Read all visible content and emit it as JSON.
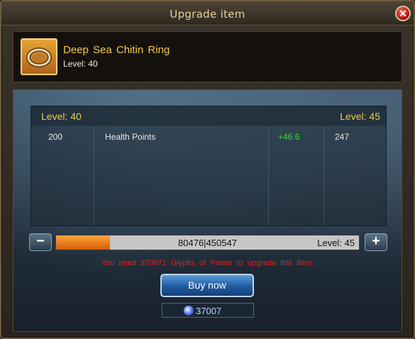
{
  "window": {
    "title": "Upgrade item"
  },
  "item": {
    "name": "Deep Sea Chitin Ring",
    "level_text": "Level: 40",
    "icon": "ring-icon"
  },
  "stats": {
    "level_left": "Level: 40",
    "level_right": "Level: 45",
    "rows": [
      {
        "base": "200",
        "name": "Health Points",
        "gain": "+46.6",
        "result": "247"
      }
    ]
  },
  "progress": {
    "current": 80476,
    "max": 450547,
    "text": "80476|450547",
    "level_text": "Level: 45",
    "minus_label": "−",
    "plus_label": "+"
  },
  "warning": "You need 370071 Glyphs of Power to upgrade this item.",
  "buy_button": "Buy now",
  "currency": {
    "icon": "glyph-of-power-icon",
    "value": "37007"
  },
  "close_icon": "close-icon"
}
